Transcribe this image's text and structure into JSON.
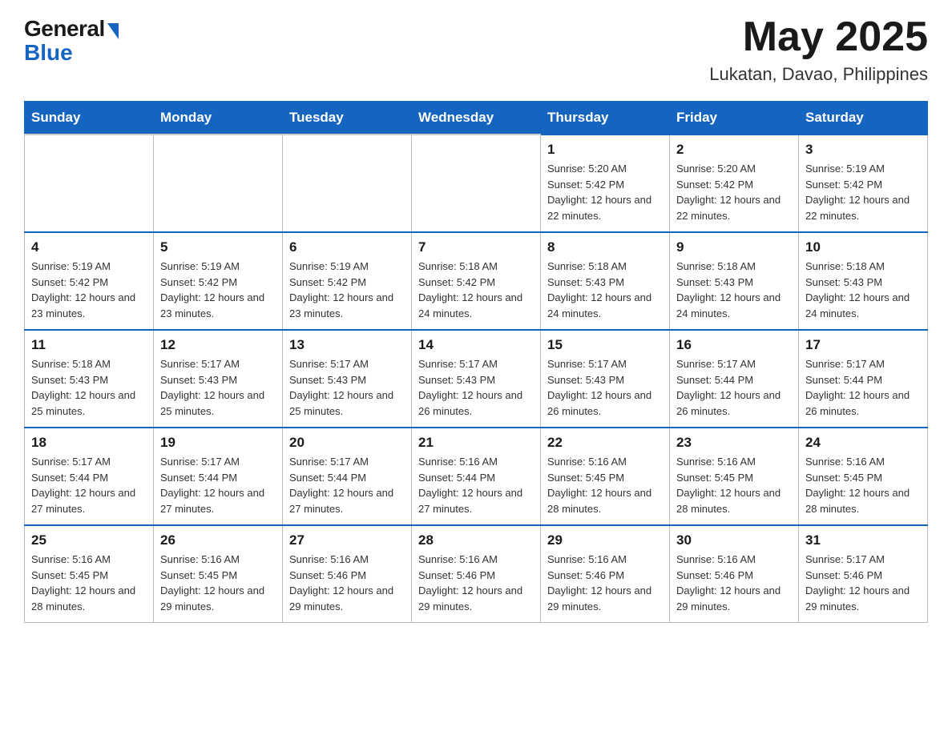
{
  "header": {
    "logo_general": "General",
    "logo_blue": "Blue",
    "month_title": "May 2025",
    "location": "Lukatan, Davao, Philippines"
  },
  "weekdays": [
    "Sunday",
    "Monday",
    "Tuesday",
    "Wednesday",
    "Thursday",
    "Friday",
    "Saturday"
  ],
  "weeks": [
    [
      {
        "day": "",
        "sunrise": "",
        "sunset": "",
        "daylight": ""
      },
      {
        "day": "",
        "sunrise": "",
        "sunset": "",
        "daylight": ""
      },
      {
        "day": "",
        "sunrise": "",
        "sunset": "",
        "daylight": ""
      },
      {
        "day": "",
        "sunrise": "",
        "sunset": "",
        "daylight": ""
      },
      {
        "day": "1",
        "sunrise": "Sunrise: 5:20 AM",
        "sunset": "Sunset: 5:42 PM",
        "daylight": "Daylight: 12 hours and 22 minutes."
      },
      {
        "day": "2",
        "sunrise": "Sunrise: 5:20 AM",
        "sunset": "Sunset: 5:42 PM",
        "daylight": "Daylight: 12 hours and 22 minutes."
      },
      {
        "day": "3",
        "sunrise": "Sunrise: 5:19 AM",
        "sunset": "Sunset: 5:42 PM",
        "daylight": "Daylight: 12 hours and 22 minutes."
      }
    ],
    [
      {
        "day": "4",
        "sunrise": "Sunrise: 5:19 AM",
        "sunset": "Sunset: 5:42 PM",
        "daylight": "Daylight: 12 hours and 23 minutes."
      },
      {
        "day": "5",
        "sunrise": "Sunrise: 5:19 AM",
        "sunset": "Sunset: 5:42 PM",
        "daylight": "Daylight: 12 hours and 23 minutes."
      },
      {
        "day": "6",
        "sunrise": "Sunrise: 5:19 AM",
        "sunset": "Sunset: 5:42 PM",
        "daylight": "Daylight: 12 hours and 23 minutes."
      },
      {
        "day": "7",
        "sunrise": "Sunrise: 5:18 AM",
        "sunset": "Sunset: 5:42 PM",
        "daylight": "Daylight: 12 hours and 24 minutes."
      },
      {
        "day": "8",
        "sunrise": "Sunrise: 5:18 AM",
        "sunset": "Sunset: 5:43 PM",
        "daylight": "Daylight: 12 hours and 24 minutes."
      },
      {
        "day": "9",
        "sunrise": "Sunrise: 5:18 AM",
        "sunset": "Sunset: 5:43 PM",
        "daylight": "Daylight: 12 hours and 24 minutes."
      },
      {
        "day": "10",
        "sunrise": "Sunrise: 5:18 AM",
        "sunset": "Sunset: 5:43 PM",
        "daylight": "Daylight: 12 hours and 24 minutes."
      }
    ],
    [
      {
        "day": "11",
        "sunrise": "Sunrise: 5:18 AM",
        "sunset": "Sunset: 5:43 PM",
        "daylight": "Daylight: 12 hours and 25 minutes."
      },
      {
        "day": "12",
        "sunrise": "Sunrise: 5:17 AM",
        "sunset": "Sunset: 5:43 PM",
        "daylight": "Daylight: 12 hours and 25 minutes."
      },
      {
        "day": "13",
        "sunrise": "Sunrise: 5:17 AM",
        "sunset": "Sunset: 5:43 PM",
        "daylight": "Daylight: 12 hours and 25 minutes."
      },
      {
        "day": "14",
        "sunrise": "Sunrise: 5:17 AM",
        "sunset": "Sunset: 5:43 PM",
        "daylight": "Daylight: 12 hours and 26 minutes."
      },
      {
        "day": "15",
        "sunrise": "Sunrise: 5:17 AM",
        "sunset": "Sunset: 5:43 PM",
        "daylight": "Daylight: 12 hours and 26 minutes."
      },
      {
        "day": "16",
        "sunrise": "Sunrise: 5:17 AM",
        "sunset": "Sunset: 5:44 PM",
        "daylight": "Daylight: 12 hours and 26 minutes."
      },
      {
        "day": "17",
        "sunrise": "Sunrise: 5:17 AM",
        "sunset": "Sunset: 5:44 PM",
        "daylight": "Daylight: 12 hours and 26 minutes."
      }
    ],
    [
      {
        "day": "18",
        "sunrise": "Sunrise: 5:17 AM",
        "sunset": "Sunset: 5:44 PM",
        "daylight": "Daylight: 12 hours and 27 minutes."
      },
      {
        "day": "19",
        "sunrise": "Sunrise: 5:17 AM",
        "sunset": "Sunset: 5:44 PM",
        "daylight": "Daylight: 12 hours and 27 minutes."
      },
      {
        "day": "20",
        "sunrise": "Sunrise: 5:17 AM",
        "sunset": "Sunset: 5:44 PM",
        "daylight": "Daylight: 12 hours and 27 minutes."
      },
      {
        "day": "21",
        "sunrise": "Sunrise: 5:16 AM",
        "sunset": "Sunset: 5:44 PM",
        "daylight": "Daylight: 12 hours and 27 minutes."
      },
      {
        "day": "22",
        "sunrise": "Sunrise: 5:16 AM",
        "sunset": "Sunset: 5:45 PM",
        "daylight": "Daylight: 12 hours and 28 minutes."
      },
      {
        "day": "23",
        "sunrise": "Sunrise: 5:16 AM",
        "sunset": "Sunset: 5:45 PM",
        "daylight": "Daylight: 12 hours and 28 minutes."
      },
      {
        "day": "24",
        "sunrise": "Sunrise: 5:16 AM",
        "sunset": "Sunset: 5:45 PM",
        "daylight": "Daylight: 12 hours and 28 minutes."
      }
    ],
    [
      {
        "day": "25",
        "sunrise": "Sunrise: 5:16 AM",
        "sunset": "Sunset: 5:45 PM",
        "daylight": "Daylight: 12 hours and 28 minutes."
      },
      {
        "day": "26",
        "sunrise": "Sunrise: 5:16 AM",
        "sunset": "Sunset: 5:45 PM",
        "daylight": "Daylight: 12 hours and 29 minutes."
      },
      {
        "day": "27",
        "sunrise": "Sunrise: 5:16 AM",
        "sunset": "Sunset: 5:46 PM",
        "daylight": "Daylight: 12 hours and 29 minutes."
      },
      {
        "day": "28",
        "sunrise": "Sunrise: 5:16 AM",
        "sunset": "Sunset: 5:46 PM",
        "daylight": "Daylight: 12 hours and 29 minutes."
      },
      {
        "day": "29",
        "sunrise": "Sunrise: 5:16 AM",
        "sunset": "Sunset: 5:46 PM",
        "daylight": "Daylight: 12 hours and 29 minutes."
      },
      {
        "day": "30",
        "sunrise": "Sunrise: 5:16 AM",
        "sunset": "Sunset: 5:46 PM",
        "daylight": "Daylight: 12 hours and 29 minutes."
      },
      {
        "day": "31",
        "sunrise": "Sunrise: 5:17 AM",
        "sunset": "Sunset: 5:46 PM",
        "daylight": "Daylight: 12 hours and 29 minutes."
      }
    ]
  ]
}
